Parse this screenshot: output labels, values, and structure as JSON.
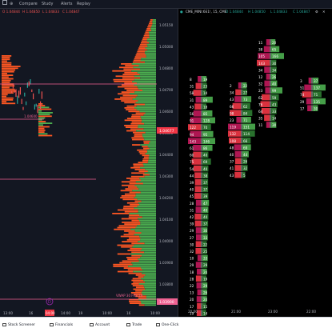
{
  "topbar": {
    "items": [
      "Compare",
      "Study",
      "Alerts",
      "Replay"
    ]
  },
  "left_chart": {
    "ohlc": [
      "O 1.04844",
      "H 1.04850",
      "L 1.04833",
      "C 1.04847"
    ],
    "price_labels": [
      "1.05150",
      "1.05000",
      "1.04800",
      "1.04700",
      "1.04600",
      "1.04500",
      "1.04400",
      "1.04300",
      "1.04200",
      "1.04100",
      "1.04000",
      "1.03900",
      "1.03800"
    ],
    "current_price": "1.04677",
    "lower_price": "1.03900",
    "left_level": "1.04600",
    "vwap_label": "VWAP 30 FRE 19",
    "time_labels": [
      "13:00",
      "16",
      "14:00",
      "19",
      "10:00",
      "16",
      "10:00"
    ],
    "highlight_time": "04:00"
  },
  "right_chart": {
    "title": "CME_MINI:6E1!, 15, CME",
    "ohlc": [
      "O 1.04844",
      "H 1.04850",
      "L 1.04833",
      "C 1.04847"
    ],
    "time_labels": [
      "20:00",
      "21:00",
      "23:00",
      "22:00"
    ],
    "columns": [
      {
        "labels": [
          "8",
          "31",
          "58",
          "31",
          "43",
          "56",
          "91",
          "122",
          "94",
          "143",
          "61",
          "60",
          "75",
          "54",
          "44",
          "39",
          "40",
          "45",
          "28",
          "31",
          "42",
          "39",
          "29",
          "27",
          "30",
          "32",
          "10",
          "29",
          "18",
          "28",
          "22",
          "13",
          "20",
          "17",
          "19",
          "10",
          "8"
        ],
        "right": [
          "19",
          "23",
          "14",
          "89",
          "18",
          "85",
          "128",
          "70",
          "95",
          "146",
          "86",
          "40",
          "69",
          "40",
          "38",
          "37",
          "37",
          "39",
          "47",
          "40",
          "40",
          "37",
          "30",
          "33",
          "22",
          "25",
          "33",
          "29",
          "24",
          "19",
          "29",
          "26",
          "24",
          "15",
          "14",
          "6",
          "8"
        ]
      },
      {
        "labels": [
          "2",
          "34",
          "43",
          "66",
          "98",
          "23",
          "119",
          "132",
          "108",
          "48",
          "40",
          "37",
          "41",
          "43"
        ],
        "right": [
          "22",
          "27",
          "73",
          "62",
          "84",
          "71",
          "151",
          "114",
          "66",
          "69",
          "44",
          "26",
          "32",
          "5"
        ]
      },
      {
        "labels": [
          "11",
          "38",
          "105",
          "143",
          "34",
          "12",
          "32",
          "23",
          "62",
          "76",
          "64",
          "35",
          "11"
        ],
        "right": [
          "20",
          "65",
          "166",
          "30",
          "34",
          "26",
          "40",
          "99",
          "59",
          "43",
          "33",
          "14",
          "30"
        ]
      },
      {
        "labels": [
          "3",
          "51",
          "74",
          "29",
          "17"
        ],
        "right": [
          "37",
          "137",
          "71",
          "135",
          "30"
        ]
      }
    ]
  },
  "bottombar": {
    "items": [
      "Stock Screener",
      "Financials",
      "Account",
      "Trade",
      "One-Click"
    ]
  },
  "colors": {
    "bg": "#131722",
    "green": "#4caf50",
    "red": "#f23645",
    "orange": "#ff5722",
    "pink": "#f06292"
  }
}
